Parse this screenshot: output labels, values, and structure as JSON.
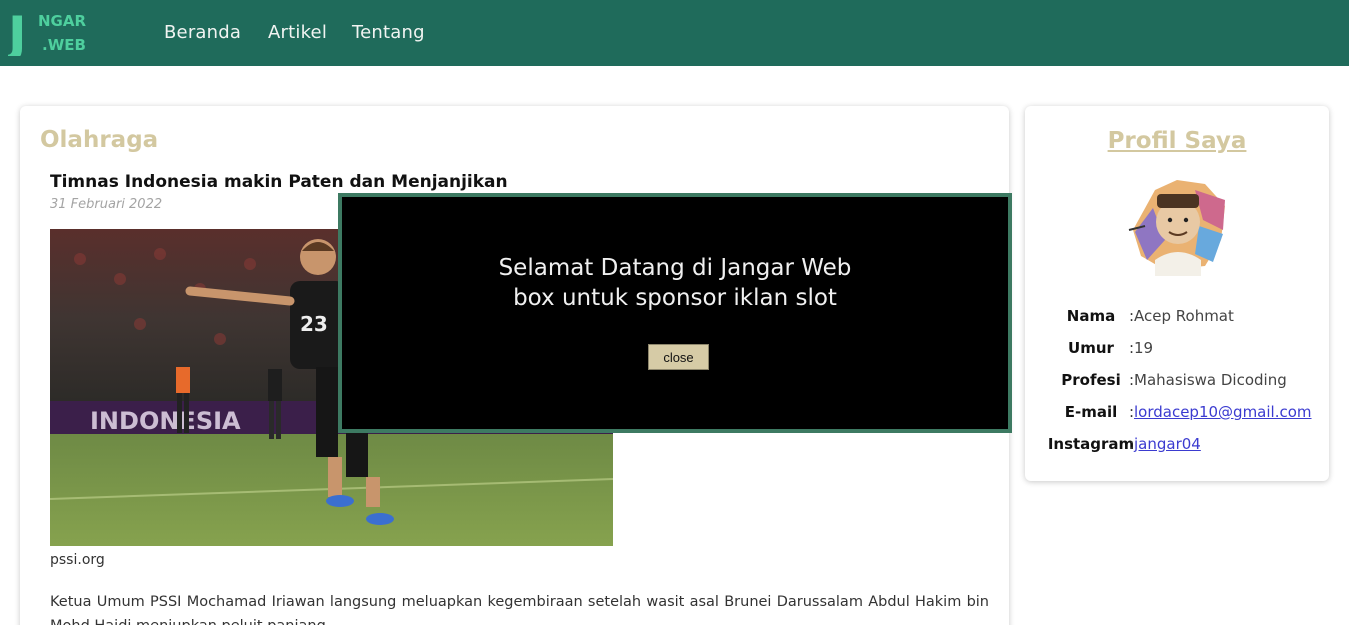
{
  "brand": {
    "logo_letter": "J",
    "logo_top": "NGAR",
    "logo_bottom": ".WEB",
    "color": "#4ecf9e"
  },
  "nav": {
    "items": [
      {
        "label": "Beranda"
      },
      {
        "label": "Artikel"
      },
      {
        "label": "Tentang"
      }
    ]
  },
  "main": {
    "section_title": "Olahraga",
    "article": {
      "title": "Timnas Indonesia makin Paten dan Menjanjikan",
      "date": "31 Februari 2022",
      "image_icon": "football-celebration-photo",
      "image_caption": "pssi.org",
      "body": "Ketua Umum PSSI Mochamad Iriawan langsung meluapkan kegembiraan setelah wasit asal Brunei Darussalam Abdul Hakim bin Mohd Haidi meniupkan peluit panjang."
    }
  },
  "profile": {
    "title": "Profil Saya",
    "avatar_icon": "portrait-avatar",
    "rows": [
      {
        "label": "Nama",
        "sep": ":",
        "value": "Acep Rohmat"
      },
      {
        "label": "Umur",
        "sep": ":",
        "value": "19"
      },
      {
        "label": "Profesi",
        "sep": ":",
        "value": "Mahasiswa Dicoding"
      },
      {
        "label": "E-mail",
        "sep": ":",
        "value": "lordacep10@gmail.com"
      },
      {
        "label": "Instagram",
        "sep": ":",
        "value": "jangar04"
      }
    ]
  },
  "modal": {
    "line1": "Selamat Datang di Jangar Web",
    "line2": "box untuk sponsor iklan slot",
    "close_label": "close"
  },
  "colors": {
    "navbar": "#1f6b5b",
    "accent_title": "#d3c8a0",
    "modal_border": "#3d7a62",
    "close_button": "#d6cba6",
    "link": "#3b3bd0"
  }
}
